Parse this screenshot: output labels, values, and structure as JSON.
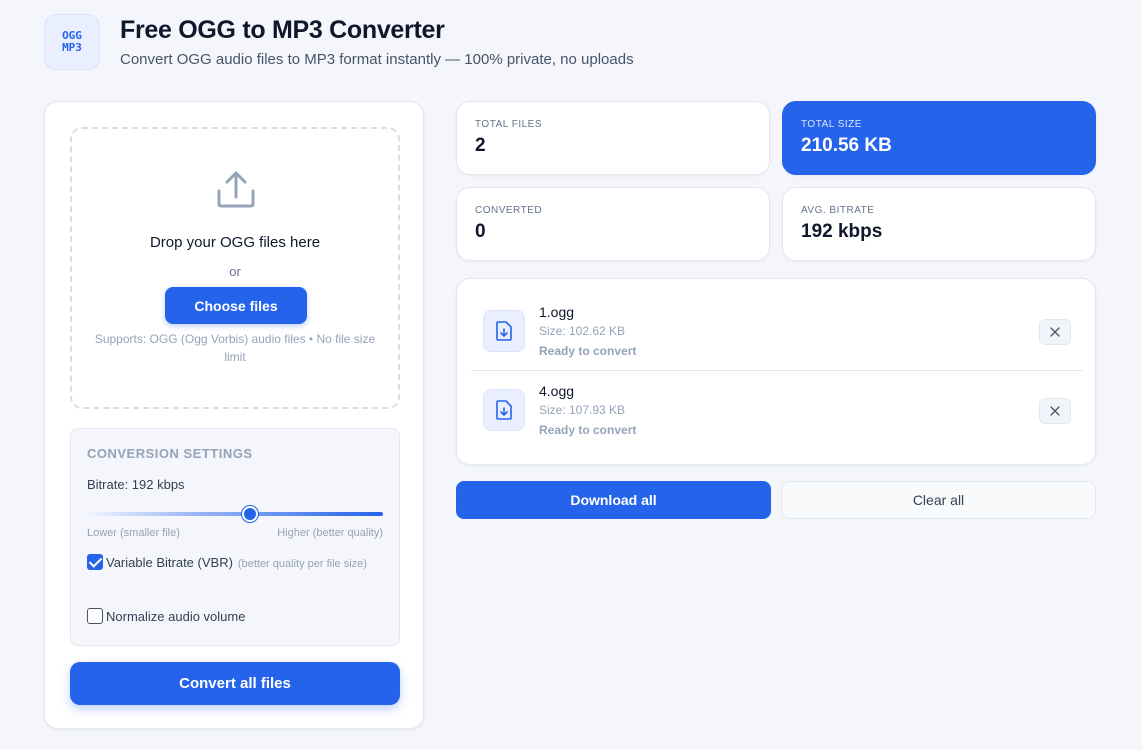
{
  "header": {
    "logo_line1": "OGG",
    "logo_line2": "MP3",
    "title": "Free OGG to MP3 Converter",
    "subtitle": "Convert OGG audio files to MP3 format instantly — 100% private, no uploads"
  },
  "dropzone": {
    "icon": "upload-icon",
    "title": "Drop your OGG files here",
    "or": "or",
    "choose_label": "Choose files",
    "supports": "Supports: OGG (Ogg Vorbis) audio files • No file size limit"
  },
  "settings": {
    "title": "CONVERSION SETTINGS",
    "bitrate_label": "Bitrate: 192 kbps",
    "slider_fraction": 0.55,
    "slider_low_label": "Lower (smaller file)",
    "slider_high_label": "Higher (better quality)",
    "vbr_label": "Variable Bitrate (VBR)",
    "vbr_hint": "(better quality per file size)",
    "vbr_checked": true,
    "normalize_label": "Normalize audio volume",
    "normalize_checked": false
  },
  "convert_label": "Convert all files",
  "stats": {
    "total_files_label": "TOTAL FILES",
    "total_files_value": "2",
    "total_size_label": "TOTAL SIZE",
    "total_size_value": "210.56 KB",
    "converted_label": "CONVERTED",
    "converted_value": "0",
    "avg_bitrate_label": "AVG. BITRATE",
    "avg_bitrate_value": "192 kbps"
  },
  "files": [
    {
      "name": "1.ogg",
      "size": "Size: 102.62 KB",
      "status": "Ready to convert"
    },
    {
      "name": "4.ogg",
      "size": "Size: 107.93 KB",
      "status": "Ready to convert"
    }
  ],
  "actions": {
    "download_all": "Download all",
    "clear_all": "Clear all"
  },
  "colors": {
    "accent": "#2563eb",
    "background": "#f4f6fb"
  }
}
